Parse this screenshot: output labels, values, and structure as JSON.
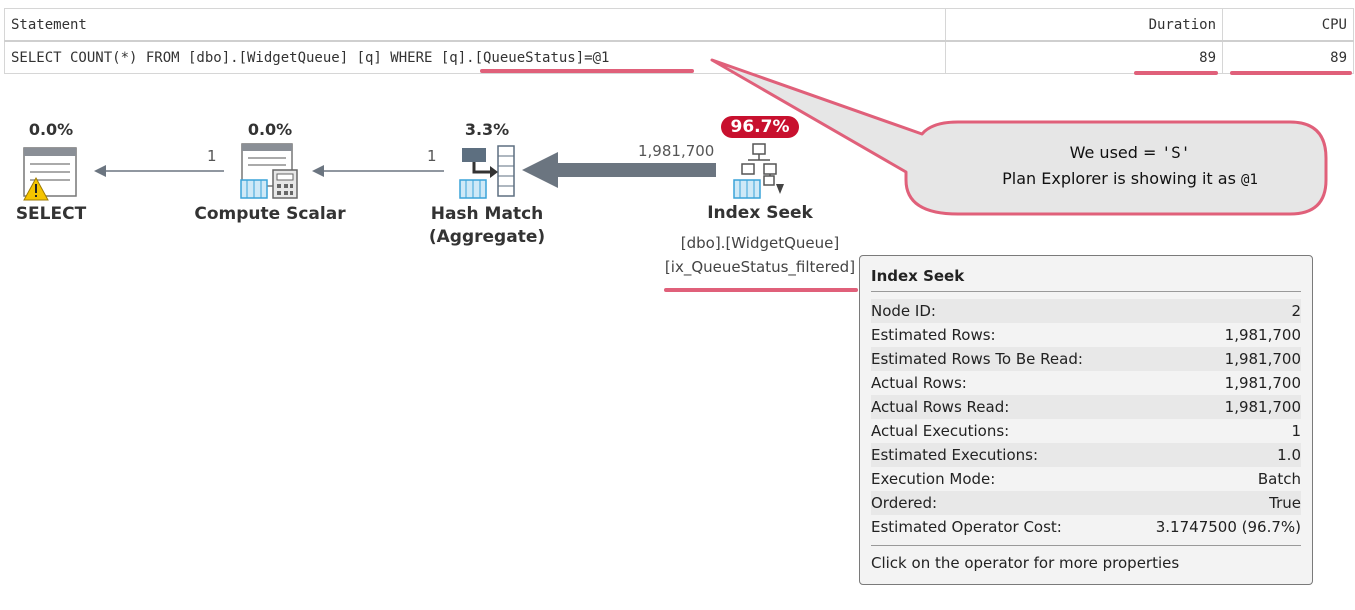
{
  "grid": {
    "headers": {
      "statement": "Statement",
      "duration": "Duration",
      "cpu": "CPU"
    },
    "row": {
      "statement": "SELECT COUNT(*) FROM [dbo].[WidgetQueue] [q] WHERE [q].[QueueStatus]=@1",
      "duration": "89",
      "cpu": "89"
    }
  },
  "plan": {
    "select": {
      "pct": "0.0%",
      "name": "SELECT"
    },
    "compute_scalar": {
      "pct": "0.0%",
      "name": "Compute Scalar"
    },
    "hash_match": {
      "pct": "3.3%",
      "name_line1": "Hash Match",
      "name_line2": "(Aggregate)"
    },
    "index_seek": {
      "pct": "96.7%",
      "name": "Index Seek",
      "object_line1": "[dbo].[WidgetQueue]",
      "object_line2": "[ix_QueueStatus_filtered]"
    },
    "arrow_rows": {
      "select_compute": "1",
      "compute_hash": "1",
      "hash_seek": "1,981,700"
    }
  },
  "callout": {
    "line1_prefix": "We used = ",
    "line1_value": "'S'",
    "line2_prefix": "Plan Explorer is showing it as ",
    "line2_value": "@1"
  },
  "tooltip": {
    "title": "Index Seek",
    "rows": [
      {
        "label": "Node ID:",
        "value": "2"
      },
      {
        "label": "Estimated Rows:",
        "value": "1,981,700"
      },
      {
        "label": "Estimated Rows To Be Read:",
        "value": "1,981,700"
      },
      {
        "label": "Actual Rows:",
        "value": "1,981,700"
      },
      {
        "label": "Actual Rows Read:",
        "value": "1,981,700"
      },
      {
        "label": "Actual Executions:",
        "value": "1"
      },
      {
        "label": "Estimated Executions:",
        "value": "1.0"
      },
      {
        "label": "Execution Mode:",
        "value": "Batch"
      },
      {
        "label": "Ordered:",
        "value": "True"
      },
      {
        "label": "Estimated Operator Cost:",
        "value": "3.1747500 (96.7%)"
      }
    ],
    "footer": "Click on the operator for more properties"
  },
  "colors": {
    "accent_red": "#c8102e",
    "annotation_pink": "#e0607a",
    "icon_blue": "#3aa3d8",
    "arrow_gray": "#6b7580"
  }
}
